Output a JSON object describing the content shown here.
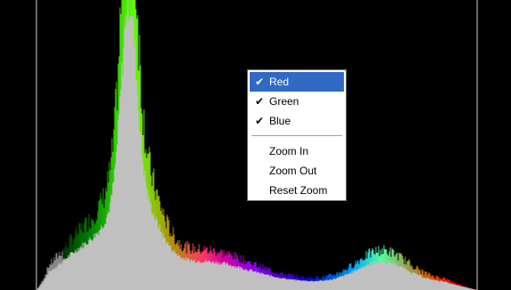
{
  "context_menu": {
    "channels": [
      {
        "label": "Red",
        "checked": true,
        "highlighted": true
      },
      {
        "label": "Green",
        "checked": true,
        "highlighted": false
      },
      {
        "label": "Blue",
        "checked": true,
        "highlighted": false
      }
    ],
    "zoom": [
      {
        "label": "Zoom In"
      },
      {
        "label": "Zoom Out"
      },
      {
        "label": "Reset Zoom"
      }
    ],
    "check_icon": "checkmark-icon"
  },
  "colors": {
    "background": "#000000",
    "luminance": "#c0c0c0",
    "guide_line": "#8a8a8a",
    "menu_highlight": "#316ac5",
    "red": "#ff0000",
    "green": "#00ff00",
    "blue": "#0000ff"
  }
}
